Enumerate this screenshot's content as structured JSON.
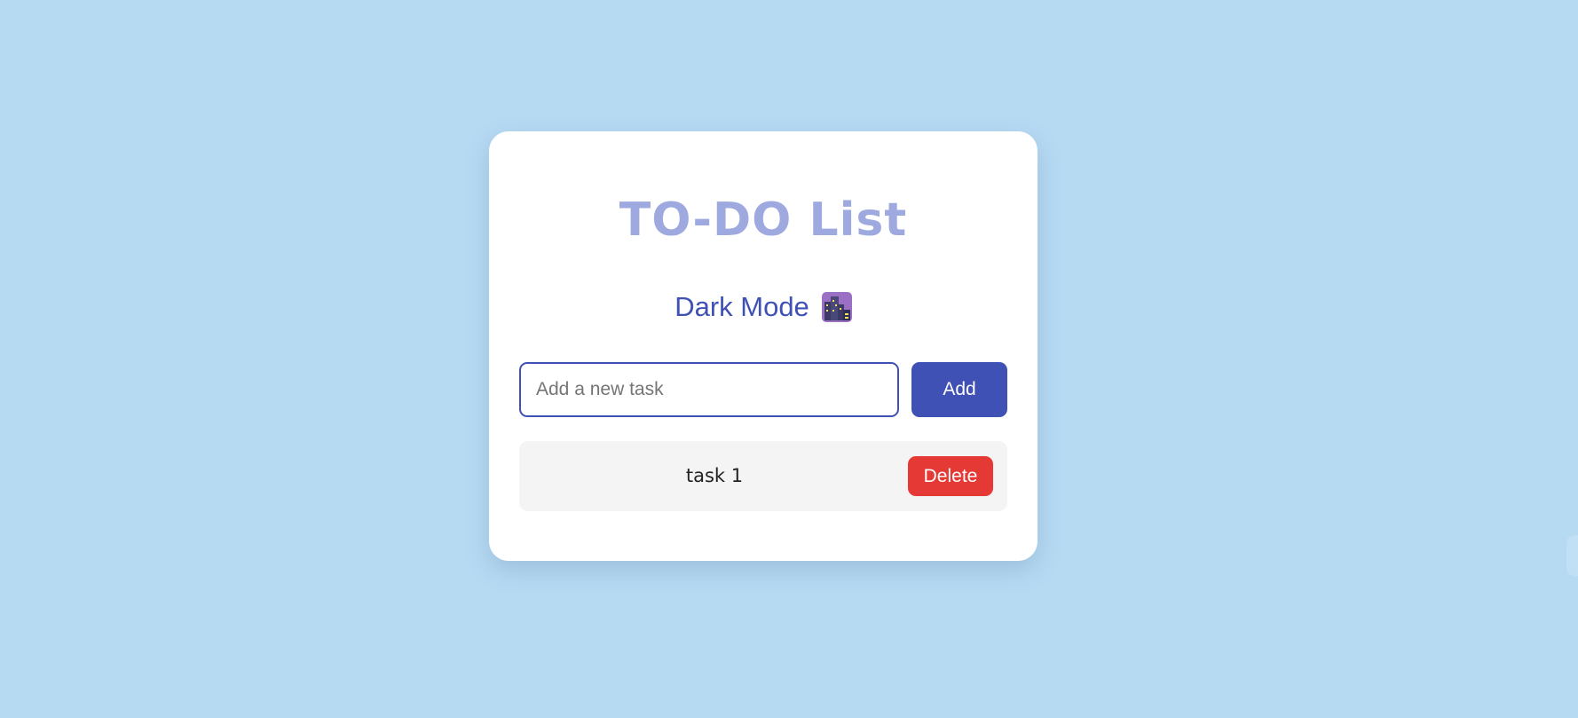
{
  "app": {
    "title": "TO-DO List"
  },
  "theme_toggle": {
    "label": "Dark Mode",
    "icon": "night-city-icon"
  },
  "new_task": {
    "placeholder": "Add a new task",
    "value": "",
    "add_label": "Add"
  },
  "tasks": [
    {
      "text": "task 1",
      "delete_label": "Delete"
    }
  ],
  "colors": {
    "background": "#b7daf3",
    "card": "#ffffff",
    "title": "#9ea9df",
    "accent": "#3f51b5",
    "danger": "#e53935",
    "task_bg": "#f4f4f4"
  }
}
